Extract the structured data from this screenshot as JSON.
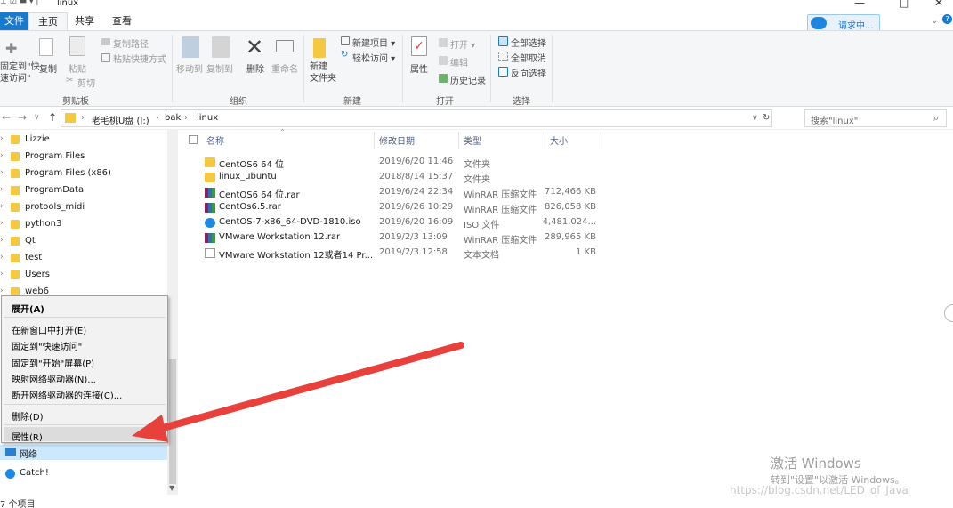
{
  "window": {
    "title": "linux",
    "controls": [
      "—",
      "□",
      "✕"
    ]
  },
  "tabs": {
    "file": "文件",
    "home": "主页",
    "share": "共享",
    "view": "查看"
  },
  "cloud_button": {
    "label": "请求中..."
  },
  "ribbon": {
    "pin": "固定到\"快\n速访问\"",
    "copy": "复制",
    "paste": "粘贴",
    "copy_path": "复制路径",
    "paste_shortcut": "粘贴快捷方式",
    "cut": "剪切",
    "group_clipboard": "剪贴板",
    "move_to": "移动到",
    "copy_to": "复制到",
    "delete": "删除",
    "rename": "重命名",
    "group_organize": "组织",
    "new_folder": "新建\n文件夹",
    "new_item": "新建项目 ▾",
    "easy_access": "轻松访问 ▾",
    "group_new": "新建",
    "properties": "属性",
    "open": "打开 ▾",
    "edit": "编辑",
    "history": "历史记录",
    "group_open": "打开",
    "select_all": "全部选择",
    "select_none": "全部取消",
    "invert_selection": "反向选择",
    "group_select": "选择"
  },
  "address": {
    "crumbs": [
      "老毛桃U盘 (J:)",
      "bak",
      "linux"
    ],
    "search_placeholder": "搜索\"linux\""
  },
  "nav_items": [
    "Lizzie",
    "Program Files",
    "Program Files (x86)",
    "ProgramData",
    "protools_midi",
    "python3",
    "Qt",
    "test",
    "Users",
    "web6"
  ],
  "nav_bottom": {
    "network": "网络",
    "catch": "Catch!"
  },
  "columns": {
    "name": "名称",
    "date": "修改日期",
    "type": "类型",
    "size": "大小"
  },
  "files": [
    {
      "name": "CentOS6 64 位",
      "date": "2019/6/20 11:46",
      "type": "文件夹",
      "size": "",
      "icon": "folder-icon"
    },
    {
      "name": "linux_ubuntu",
      "date": "2018/8/14 15:37",
      "type": "文件夹",
      "size": "",
      "icon": "folder-icon"
    },
    {
      "name": "CentOS6 64 位.rar",
      "date": "2019/6/24 22:34",
      "type": "WinRAR 压缩文件",
      "size": "712,466 KB",
      "icon": "rar-icon"
    },
    {
      "name": "CentOs6.5.rar",
      "date": "2019/6/26 10:29",
      "type": "WinRAR 压缩文件",
      "size": "826,058 KB",
      "icon": "rar-icon"
    },
    {
      "name": "CentOS-7-x86_64-DVD-1810.iso",
      "date": "2019/6/20 16:09",
      "type": "ISO 文件",
      "size": "4,481,024...",
      "icon": "iso-icon"
    },
    {
      "name": "VMware Workstation 12.rar",
      "date": "2019/2/3 13:09",
      "type": "WinRAR 压缩文件",
      "size": "289,965 KB",
      "icon": "rar-icon"
    },
    {
      "name": "VMware Workstation 12或者14 Pr...",
      "date": "2019/2/3 12:58",
      "type": "文本文档",
      "size": "1 KB",
      "icon": "text-file-icon"
    }
  ],
  "context_menu": {
    "expand": "展开(A)",
    "open_new_window": "在新窗口中打开(E)",
    "pin_quick_access": "固定到\"快速访问\"",
    "pin_start": "固定到\"开始\"屏幕(P)",
    "map_drive": "映射网络驱动器(N)...",
    "disconnect_drive": "断开网络驱动器的连接(C)...",
    "delete": "删除(D)",
    "properties": "属性(R)"
  },
  "status": {
    "items": "7 个项目"
  },
  "watermark": {
    "line1": "激活 Windows",
    "line2": "转到\"设置\"以激活 Windows。",
    "url": "https://blog.csdn.net/LED_of_Java"
  },
  "colors": {
    "accent": "#1979ca",
    "arrow": "#e8403a",
    "selection": "#cce8ff"
  }
}
